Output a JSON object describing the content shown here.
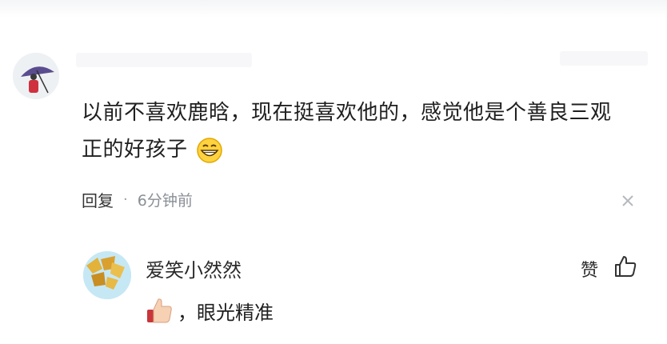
{
  "comment": {
    "avatar_icon": "user-avatar-umbrella",
    "text_line1": "以前不喜欢鹿晗，现在挺喜欢他的，感觉他是个善良三观",
    "text_line2": "正的好孩子",
    "emoji": "grinning-face-emoji",
    "reply_label": "回复",
    "separator": "·",
    "time": "6分钟前",
    "close_icon": "close-icon"
  },
  "reply": {
    "avatar_icon": "user-avatar-leaves",
    "username": "爱笑小然然",
    "like_label": "赞",
    "like_icon": "thumbs-up-outline-icon",
    "emoji": "thumbs-up-emoji",
    "text": "，眼光精准"
  },
  "colors": {
    "text": "#1f1f1f",
    "meta": "#8a8f96",
    "background": "#ffffff"
  }
}
